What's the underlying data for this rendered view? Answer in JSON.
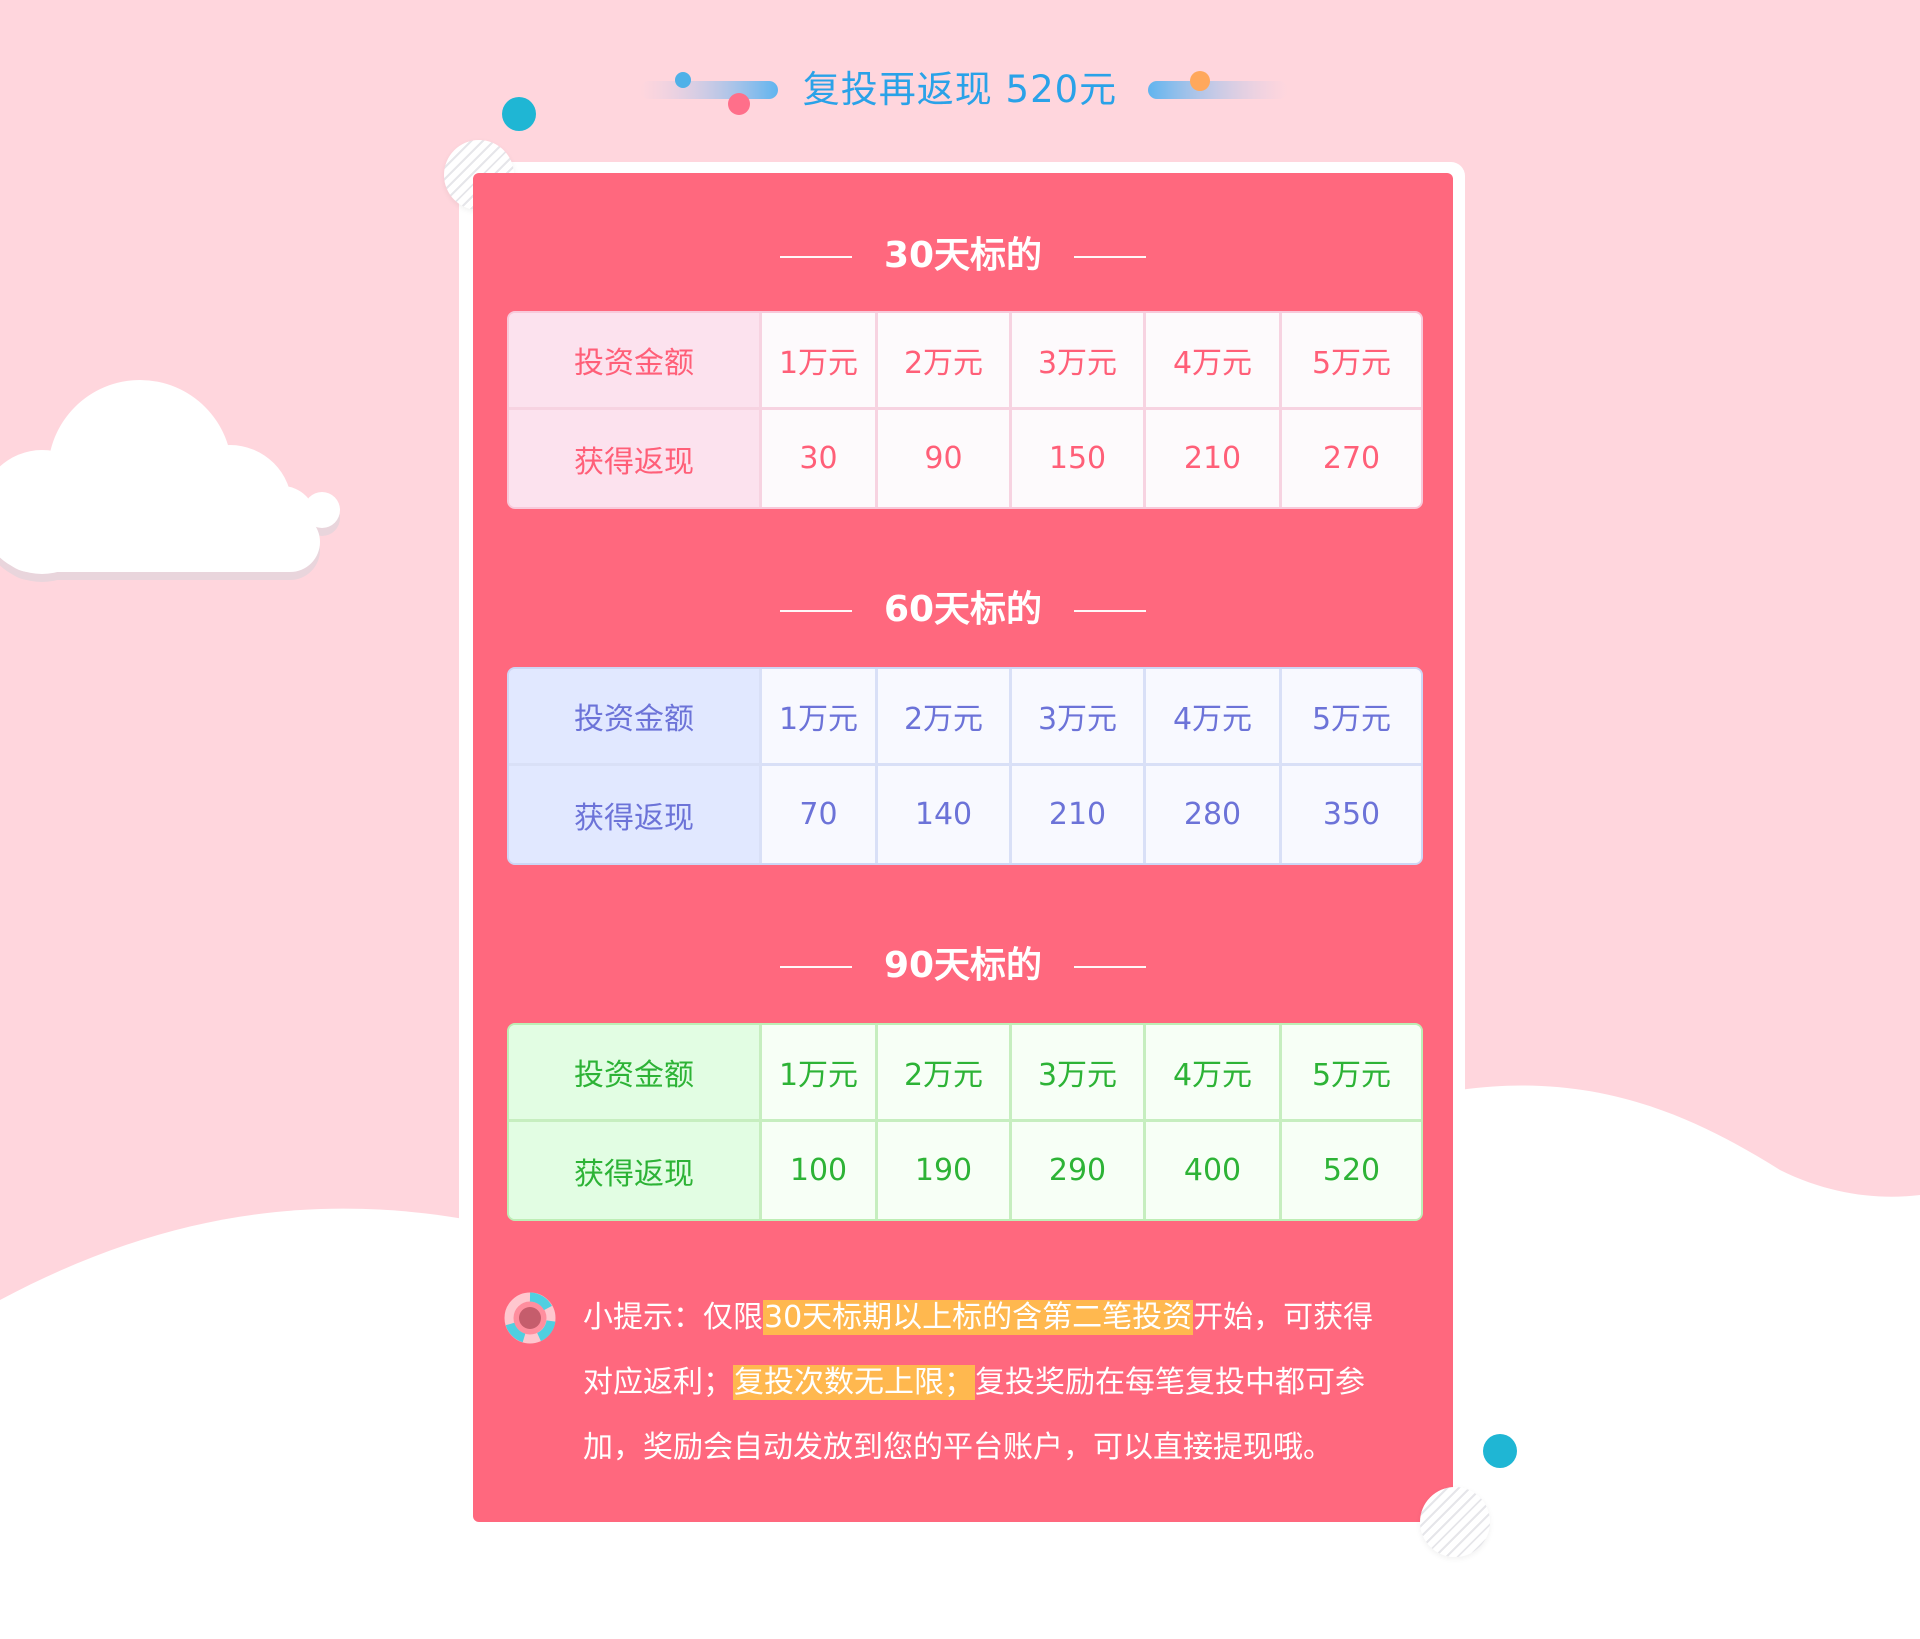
{
  "header": {
    "title": "复投再返现 520元"
  },
  "sections": [
    {
      "title": "30天标的",
      "theme_color": "#ff5f78",
      "row_labels": [
        "投资金额",
        "获得返现"
      ],
      "amounts": [
        "1万元",
        "2万元",
        "3万元",
        "4万元",
        "5万元"
      ],
      "cashback": [
        "30",
        "90",
        "150",
        "210",
        "270"
      ]
    },
    {
      "title": "60天标的",
      "theme_color": "#6c73d8",
      "row_labels": [
        "投资金额",
        "获得返现"
      ],
      "amounts": [
        "1万元",
        "2万元",
        "3万元",
        "4万元",
        "5万元"
      ],
      "cashback": [
        "70",
        "140",
        "210",
        "280",
        "350"
      ]
    },
    {
      "title": "90天标的",
      "theme_color": "#2db336",
      "row_labels": [
        "投资金额",
        "获得返现"
      ],
      "amounts": [
        "1万元",
        "2万元",
        "3万元",
        "4万元",
        "5万元"
      ],
      "cashback": [
        "100",
        "190",
        "290",
        "400",
        "520"
      ]
    }
  ],
  "tip": {
    "icon": "lifebuoy-icon",
    "prefix": "小提示：仅限",
    "highlight_1": "30天标期以上标的含第二笔投资",
    "middle": "开始，可获得对应返利；",
    "highlight_2": "复投次数无上限；",
    "suffix": "复投奖励在每笔复投中都可参加，奖励会自动发放到您的平台账户，可以直接提现哦。"
  },
  "colors": {
    "background": "#ffd6dd",
    "card": "#ff687e",
    "accent": "#2aa2e8",
    "highlight": "#ffb84f"
  }
}
